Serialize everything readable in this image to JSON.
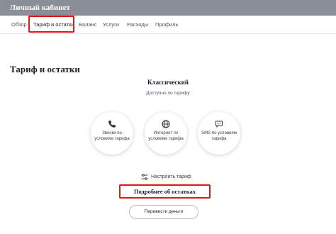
{
  "header": {
    "title": "Личный кабинет"
  },
  "nav": {
    "tabs": [
      {
        "label": "Обзор"
      },
      {
        "label": "Тариф и остатки"
      },
      {
        "label": "Баланс"
      },
      {
        "label": "Услуги"
      },
      {
        "label": "Расходы"
      },
      {
        "label": "Профиль"
      }
    ],
    "active": "Тариф и остатки"
  },
  "main": {
    "title": "Тариф и остатки",
    "plan_name": "Классический",
    "plan_subtitle": "Доступно по тарифу",
    "features": [
      {
        "icon": "phone-icon",
        "label": "Звонки по условиям тарифа"
      },
      {
        "icon": "globe-icon",
        "label": "Интернет по условиям тарифа"
      },
      {
        "icon": "message-icon",
        "label": "SMS по условиям тарифа"
      }
    ],
    "configure_label": "Настроить тариф",
    "details_label": "Подробнее об остатках",
    "transfer_button": "Перевести деньги"
  },
  "colors": {
    "topbar": "#8a8f97",
    "highlight": "#e0161b"
  }
}
